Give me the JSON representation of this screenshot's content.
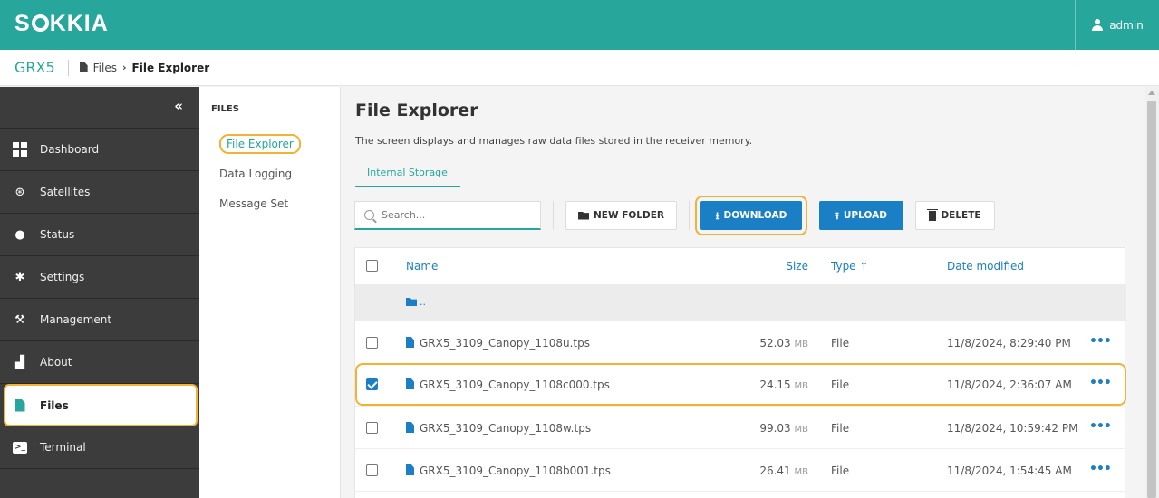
{
  "app": {
    "brand": "SOKKIA",
    "brand_pre": "S",
    "brand_post": "KKIA",
    "user": "admin"
  },
  "breadcrumb": {
    "device": "GRX5",
    "section": "Files",
    "current": "File Explorer"
  },
  "sidebar": {
    "collapse_glyph": "«",
    "items": [
      {
        "label": "Dashboard",
        "icon": "dashboard-icon"
      },
      {
        "label": "Satellites",
        "icon": "satellite-icon"
      },
      {
        "label": "Status",
        "icon": "location-pin-icon"
      },
      {
        "label": "Settings",
        "icon": "gear-icon"
      },
      {
        "label": "Management",
        "icon": "wrench-icon"
      },
      {
        "label": "About",
        "icon": "receiver-icon"
      },
      {
        "label": "Files",
        "icon": "file-icon",
        "active": true
      },
      {
        "label": "Terminal",
        "icon": "terminal-icon"
      }
    ]
  },
  "subnav": {
    "title": "FILES",
    "items": [
      {
        "label": "File Explorer",
        "active": true
      },
      {
        "label": "Data Logging"
      },
      {
        "label": "Message Set"
      }
    ]
  },
  "main": {
    "title": "File Explorer",
    "description": "The screen displays and manages raw data files stored in the receiver memory.",
    "tab": "Internal Storage"
  },
  "toolbar": {
    "search_placeholder": "Search...",
    "new_folder": "NEW FOLDER",
    "download": "DOWNLOAD",
    "upload": "UPLOAD",
    "delete": "DELETE"
  },
  "table": {
    "headers": {
      "name": "Name",
      "size": "Size",
      "type": "Type ↑",
      "date": "Date modified"
    },
    "parent": "..",
    "rows": [
      {
        "name": "GRX5_3109_Canopy_1108u.tps",
        "size": "52.03",
        "unit": "MB",
        "type": "File",
        "date": "11/8/2024, 8:29:40 PM",
        "checked": false
      },
      {
        "name": "GRX5_3109_Canopy_1108c000.tps",
        "size": "24.15",
        "unit": "MB",
        "type": "File",
        "date": "11/8/2024, 2:36:07 AM",
        "checked": true
      },
      {
        "name": "GRX5_3109_Canopy_1108w.tps",
        "size": "99.03",
        "unit": "MB",
        "type": "File",
        "date": "11/8/2024, 10:59:42 PM",
        "checked": false
      },
      {
        "name": "GRX5_3109_Canopy_1108b001.tps",
        "size": "26.41",
        "unit": "MB",
        "type": "File",
        "date": "11/8/2024, 1:54:45 AM",
        "checked": false
      }
    ],
    "more_glyph": "•••"
  },
  "colors": {
    "brand_teal": "#27a79b",
    "primary_blue": "#1a7fc4",
    "highlight": "#f2b233",
    "sidebar_bg": "#3c3c3c"
  }
}
